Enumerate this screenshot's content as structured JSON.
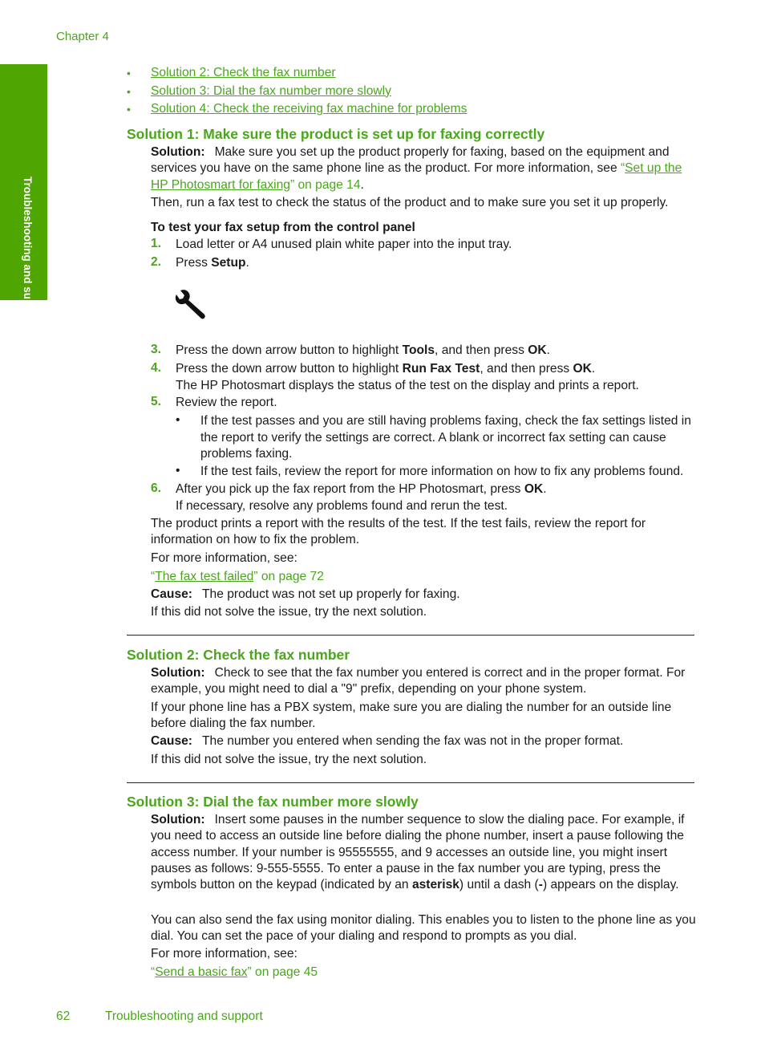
{
  "header": {
    "chapter": "Chapter 4"
  },
  "side_tab": {
    "label": "Troubleshooting and support"
  },
  "toc_links": [
    "Solution 2: Check the fax number",
    "Solution 3: Dial the fax number more slowly",
    "Solution 4: Check the receiving fax machine for problems"
  ],
  "solution1": {
    "heading": "Solution 1: Make sure the product is set up for faxing correctly",
    "solution_label": "Solution:",
    "solution_text": "Make sure you set up the product properly for faxing, based on the equipment and services you have on the same phone line as the product. For more information, see ",
    "ref_open": "“",
    "ref_link": "Set up the HP Photosmart for faxing",
    "ref_close": "” on page 14",
    "period": ".",
    "then_text": "Then, run a fax test to check the status of the product and to make sure you set it up properly.",
    "procedure_title": "To test your fax setup from the control panel",
    "steps": [
      {
        "num": "1.",
        "text": "Load letter or A4 unused plain white paper into the input tray."
      },
      {
        "num": "2.",
        "pre": "Press ",
        "bold": "Setup",
        "post": "."
      },
      {
        "num": "3.",
        "pre": "Press the down arrow button to highlight ",
        "bold": "Tools",
        "mid": ", and then press ",
        "bold2": "OK",
        "post": "."
      },
      {
        "num": "4.",
        "pre": "Press the down arrow button to highlight ",
        "bold": "Run Fax Test",
        "mid": ", and then press ",
        "bold2": "OK",
        "post": ".",
        "note": "The HP Photosmart displays the status of the test on the display and prints a report."
      },
      {
        "num": "5.",
        "text": "Review the report."
      },
      {
        "num": "6.",
        "pre": "After you pick up the fax report from the HP Photosmart, press ",
        "bold": "OK",
        "post": ".",
        "note": "If necessary, resolve any problems found and rerun the test."
      }
    ],
    "step5_bullets": [
      "If the test passes and you are still having problems faxing, check the fax settings listed in the report to verify the settings are correct. A blank or incorrect fax setting can cause problems faxing.",
      "If the test fails, review the report for more information on how to fix any problems found."
    ],
    "setup_icon": "wrench-icon",
    "result_text": "The product prints a report with the results of the test. If the test fails, review the report for information on how to fix the problem.",
    "more_info": "For more information, see:",
    "more_ref_link": "The fax test failed",
    "more_ref_page": "” on page 72",
    "cause_label": "Cause:",
    "cause_text": "The product was not set up properly for faxing.",
    "next": "If this did not solve the issue, try the next solution."
  },
  "solution2": {
    "heading": "Solution 2: Check the fax number",
    "solution_label": "Solution:",
    "solution_text": "Check to see that the fax number you entered is correct and in the proper format. For example, you might need to dial a \"9\" prefix, depending on your phone system.",
    "pbx_text": "If your phone line has a PBX system, make sure you are dialing the number for an outside line before dialing the fax number.",
    "cause_label": "Cause:",
    "cause_text": "The number you entered when sending the fax was not in the proper format.",
    "next": "If this did not solve the issue, try the next solution."
  },
  "solution3": {
    "heading": "Solution 3: Dial the fax number more slowly",
    "solution_label": "Solution:",
    "solution_text_a": "Insert some pauses in the number sequence to slow the dialing pace. For example, if you need to access an outside line before dialing the phone number, insert a pause following the access number. If your number is 95555555, and 9 accesses an outside line, you might insert pauses as follows: 9-555-5555. To enter a pause in the fax number you are typing, press the symbols button on the keypad (indicated by an ",
    "bold_asterisk": "asterisk",
    "solution_text_b": ") until a dash (",
    "bold_dash": "-",
    "solution_text_c": ") appears on the display.",
    "monitor_text": "You can also send the fax using monitor dialing. This enables you to listen to the phone line as you dial. You can set the pace of your dialing and respond to prompts as you dial.",
    "more_info": "For more information, see:",
    "ref_link": "Send a basic fax",
    "ref_page": "” on page 45"
  },
  "footer": {
    "page_number": "62",
    "section": "Troubleshooting and support"
  }
}
